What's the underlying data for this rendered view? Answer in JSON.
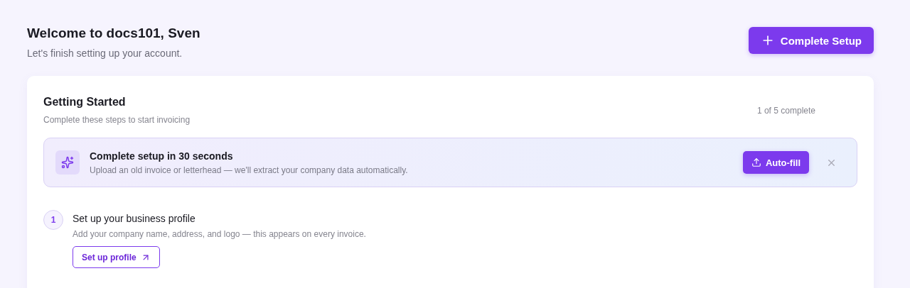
{
  "header": {
    "title": "Welcome to docs101, Sven",
    "subtitle": "Let's finish setting up your account.",
    "action": {
      "label": "Complete Setup"
    }
  },
  "card": {
    "title": "Getting Started",
    "subtitle": "Complete these steps to start invoicing",
    "progress": "1 of 5 complete",
    "banner": {
      "title": "Complete setup in 30 seconds",
      "text": "Upload an old invoice or letterhead — we'll extract your company data automatically.",
      "action": {
        "label": "Auto-fill"
      },
      "dismissible": true
    },
    "steps": [
      {
        "number": "1",
        "title": "Set up your business profile",
        "text": "Add your company name, address, and logo — this appears on every invoice.",
        "action": {
          "label": "Set up profile"
        }
      }
    ]
  }
}
